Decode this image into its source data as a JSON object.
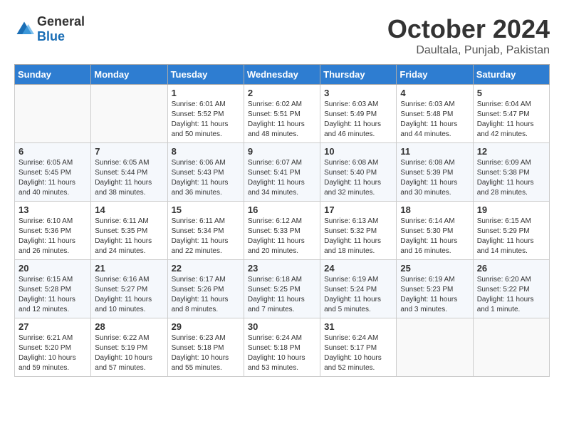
{
  "logo": {
    "general": "General",
    "blue": "Blue"
  },
  "title": "October 2024",
  "location": "Daultala, Punjab, Pakistan",
  "weekdays": [
    "Sunday",
    "Monday",
    "Tuesday",
    "Wednesday",
    "Thursday",
    "Friday",
    "Saturday"
  ],
  "weeks": [
    [
      {
        "num": "",
        "empty": true
      },
      {
        "num": "",
        "empty": true
      },
      {
        "num": "1",
        "sunrise": "6:01 AM",
        "sunset": "5:52 PM",
        "daylight": "11 hours and 50 minutes."
      },
      {
        "num": "2",
        "sunrise": "6:02 AM",
        "sunset": "5:51 PM",
        "daylight": "11 hours and 48 minutes."
      },
      {
        "num": "3",
        "sunrise": "6:03 AM",
        "sunset": "5:49 PM",
        "daylight": "11 hours and 46 minutes."
      },
      {
        "num": "4",
        "sunrise": "6:03 AM",
        "sunset": "5:48 PM",
        "daylight": "11 hours and 44 minutes."
      },
      {
        "num": "5",
        "sunrise": "6:04 AM",
        "sunset": "5:47 PM",
        "daylight": "11 hours and 42 minutes."
      }
    ],
    [
      {
        "num": "6",
        "sunrise": "6:05 AM",
        "sunset": "5:45 PM",
        "daylight": "11 hours and 40 minutes."
      },
      {
        "num": "7",
        "sunrise": "6:05 AM",
        "sunset": "5:44 PM",
        "daylight": "11 hours and 38 minutes."
      },
      {
        "num": "8",
        "sunrise": "6:06 AM",
        "sunset": "5:43 PM",
        "daylight": "11 hours and 36 minutes."
      },
      {
        "num": "9",
        "sunrise": "6:07 AM",
        "sunset": "5:41 PM",
        "daylight": "11 hours and 34 minutes."
      },
      {
        "num": "10",
        "sunrise": "6:08 AM",
        "sunset": "5:40 PM",
        "daylight": "11 hours and 32 minutes."
      },
      {
        "num": "11",
        "sunrise": "6:08 AM",
        "sunset": "5:39 PM",
        "daylight": "11 hours and 30 minutes."
      },
      {
        "num": "12",
        "sunrise": "6:09 AM",
        "sunset": "5:38 PM",
        "daylight": "11 hours and 28 minutes."
      }
    ],
    [
      {
        "num": "13",
        "sunrise": "6:10 AM",
        "sunset": "5:36 PM",
        "daylight": "11 hours and 26 minutes."
      },
      {
        "num": "14",
        "sunrise": "6:11 AM",
        "sunset": "5:35 PM",
        "daylight": "11 hours and 24 minutes."
      },
      {
        "num": "15",
        "sunrise": "6:11 AM",
        "sunset": "5:34 PM",
        "daylight": "11 hours and 22 minutes."
      },
      {
        "num": "16",
        "sunrise": "6:12 AM",
        "sunset": "5:33 PM",
        "daylight": "11 hours and 20 minutes."
      },
      {
        "num": "17",
        "sunrise": "6:13 AM",
        "sunset": "5:32 PM",
        "daylight": "11 hours and 18 minutes."
      },
      {
        "num": "18",
        "sunrise": "6:14 AM",
        "sunset": "5:30 PM",
        "daylight": "11 hours and 16 minutes."
      },
      {
        "num": "19",
        "sunrise": "6:15 AM",
        "sunset": "5:29 PM",
        "daylight": "11 hours and 14 minutes."
      }
    ],
    [
      {
        "num": "20",
        "sunrise": "6:15 AM",
        "sunset": "5:28 PM",
        "daylight": "11 hours and 12 minutes."
      },
      {
        "num": "21",
        "sunrise": "6:16 AM",
        "sunset": "5:27 PM",
        "daylight": "11 hours and 10 minutes."
      },
      {
        "num": "22",
        "sunrise": "6:17 AM",
        "sunset": "5:26 PM",
        "daylight": "11 hours and 8 minutes."
      },
      {
        "num": "23",
        "sunrise": "6:18 AM",
        "sunset": "5:25 PM",
        "daylight": "11 hours and 7 minutes."
      },
      {
        "num": "24",
        "sunrise": "6:19 AM",
        "sunset": "5:24 PM",
        "daylight": "11 hours and 5 minutes."
      },
      {
        "num": "25",
        "sunrise": "6:19 AM",
        "sunset": "5:23 PM",
        "daylight": "11 hours and 3 minutes."
      },
      {
        "num": "26",
        "sunrise": "6:20 AM",
        "sunset": "5:22 PM",
        "daylight": "11 hours and 1 minute."
      }
    ],
    [
      {
        "num": "27",
        "sunrise": "6:21 AM",
        "sunset": "5:20 PM",
        "daylight": "10 hours and 59 minutes."
      },
      {
        "num": "28",
        "sunrise": "6:22 AM",
        "sunset": "5:19 PM",
        "daylight": "10 hours and 57 minutes."
      },
      {
        "num": "29",
        "sunrise": "6:23 AM",
        "sunset": "5:18 PM",
        "daylight": "10 hours and 55 minutes."
      },
      {
        "num": "30",
        "sunrise": "6:24 AM",
        "sunset": "5:18 PM",
        "daylight": "10 hours and 53 minutes."
      },
      {
        "num": "31",
        "sunrise": "6:24 AM",
        "sunset": "5:17 PM",
        "daylight": "10 hours and 52 minutes."
      },
      {
        "num": "",
        "empty": true
      },
      {
        "num": "",
        "empty": true
      }
    ]
  ]
}
